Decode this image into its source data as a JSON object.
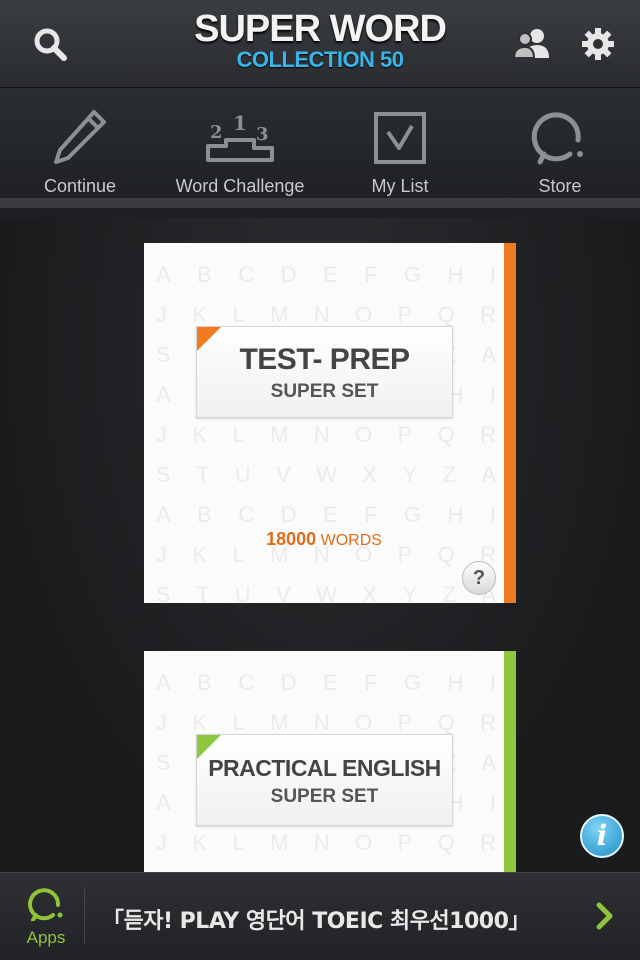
{
  "header": {
    "title": "SUPER WORD",
    "subtitle": "COLLECTION 50",
    "left_icon": "search-icon",
    "right_icons": [
      "friends-icon",
      "gear-icon"
    ]
  },
  "nav": {
    "items": [
      {
        "label": "Continue",
        "icon": "pencil-icon"
      },
      {
        "label": "Word Challenge",
        "icon": "podium-icon"
      },
      {
        "label": "My List",
        "icon": "checkbox-icon"
      },
      {
        "label": "Store",
        "icon": "store-icon"
      }
    ]
  },
  "cards": [
    {
      "title": "TEST- PREP",
      "subtitle": "SUPER SET",
      "word_count": "18000",
      "word_unit": "WORDS",
      "accent_color": "#f07a1f",
      "help": "?"
    },
    {
      "title": "PRACTICAL ENGLISH",
      "subtitle": "SUPER SET",
      "accent_color": "#8ec63f"
    }
  ],
  "letter_rows": [
    [
      "A",
      "B",
      "C",
      "D",
      "E",
      "F",
      "G",
      "H",
      "I"
    ],
    [
      "J",
      "K",
      "L",
      "M",
      "N",
      "O",
      "P",
      "Q",
      "R"
    ],
    [
      "S",
      "T",
      "U",
      "V",
      "W",
      "X",
      "Y",
      "Z",
      "A"
    ],
    [
      "A",
      "B",
      "C",
      "D",
      "E",
      "F",
      "G",
      "H",
      "I"
    ],
    [
      "J",
      "K",
      "L",
      "M",
      "N",
      "O",
      "P",
      "Q",
      "R"
    ],
    [
      "S",
      "T",
      "U",
      "V",
      "W",
      "X",
      "Y",
      "Z",
      "A"
    ],
    [
      "A",
      "B",
      "C",
      "D",
      "E",
      "F",
      "G",
      "H",
      "I"
    ],
    [
      "J",
      "K",
      "L",
      "M",
      "N",
      "O",
      "P",
      "Q",
      "R"
    ],
    [
      "S",
      "T",
      "U",
      "V",
      "W",
      "X",
      "Y",
      "Z",
      "A"
    ]
  ],
  "info": "i",
  "bottom": {
    "apps_label": "Apps",
    "promo_text": "「듣자! PLAY 영단어 TOEIC 최우선1000」",
    "arrow_icon": "chevron-right-icon"
  },
  "colors": {
    "subtitle_blue": "#3bb4e8",
    "apps_green": "#8fc43a",
    "orange": "#f07a1f",
    "green": "#8ec63f"
  }
}
